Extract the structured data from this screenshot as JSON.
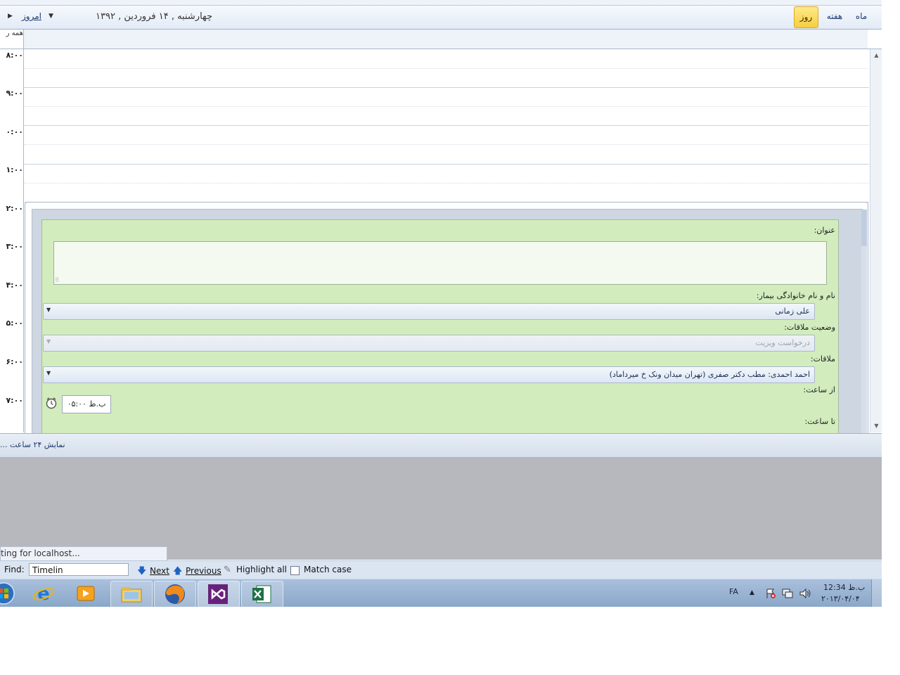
{
  "header": {
    "today_label": "امروز",
    "date_title": "چهارشنبه , ۱۴  فروردین , ۱۳۹۲",
    "views": [
      {
        "label": "روز",
        "active": true
      },
      {
        "label": "هفته",
        "active": false
      },
      {
        "label": "ماه",
        "active": false
      }
    ]
  },
  "allday_label": "همه ر",
  "time_labels": [
    "۸:۰۰",
    "۹:۰۰",
    "۰:۰۰",
    "۱:۰۰",
    "۲:۰۰",
    "۳:۰۰",
    "۴:۰۰",
    "۵:۰۰",
    "۶:۰۰",
    "۷:۰۰"
  ],
  "form": {
    "title_label": "عنوان:",
    "patient_label": "نام و نام خانوادگی بیمار:",
    "patient_value": "علی زمانی",
    "status_label": "وضعیت ملاقات:",
    "status_value": "درخواست ویزیت",
    "appointment_label": "ملاقات:",
    "appointment_value": "احمد احمدی: مطب دکتر صفری (تهران میدان ونک خ میرداماد)",
    "from_time_label": "از ساعت:",
    "from_time_value": "۰۵:۰۰ ب.ظ",
    "to_time_label": "تا ساعت:"
  },
  "footer": {
    "show24_text": "... نمایش ۲۴ ساعت"
  },
  "browser": {
    "status_text": "ting for localhost...",
    "find_label": "Find:",
    "find_value": "Timelin",
    "next_label": "Next",
    "previous_label": "Previous",
    "highlight_label": "Highlight all",
    "matchcase_label": "Match case"
  },
  "taskbar": {
    "language": "FA",
    "clock_time": "ب.ظ 12:34",
    "clock_date": "۲۰۱۳/۰۴/۰۴"
  },
  "colors": {
    "form_bg": "#d2ecbd",
    "active_view": "#f7cf3f",
    "accent_text": "#1f3a70"
  }
}
